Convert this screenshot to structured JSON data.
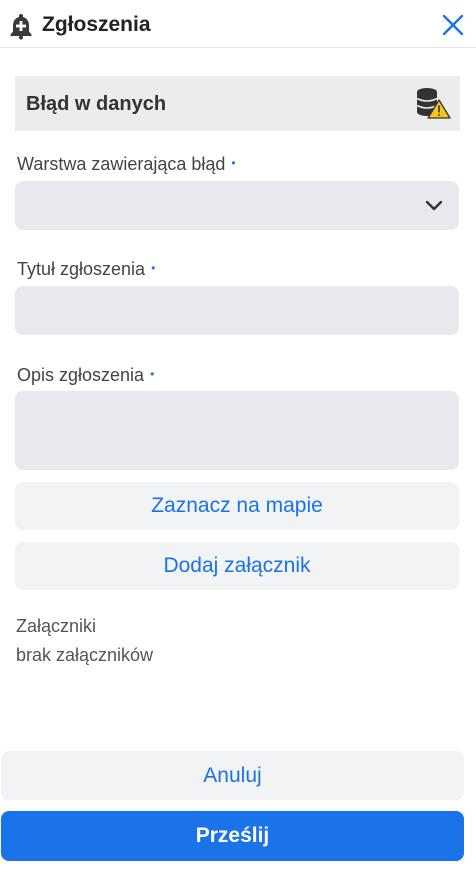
{
  "header": {
    "title": "Zgłoszenia",
    "icon": "bell-plus-icon",
    "close_icon": "close-icon"
  },
  "section": {
    "title": "Błąd w danych",
    "icon": "database-warning-icon"
  },
  "form": {
    "layer": {
      "label": "Warstwa zawierająca błąd",
      "value": ""
    },
    "title": {
      "label": "Tytuł zgłoszenia",
      "value": ""
    },
    "description": {
      "label": "Opis zgłoszenia",
      "value": ""
    },
    "required_marker": "•"
  },
  "buttons": {
    "mark_on_map": "Zaznacz na mapie",
    "add_attachment": "Dodaj załącznik",
    "cancel": "Anuluj",
    "submit": "Prześlij"
  },
  "attachments": {
    "heading": "Załączniki",
    "empty_text": "brak załączników"
  },
  "colors": {
    "accent": "#1a73e8",
    "field_bg": "#e7e9ed",
    "section_bg": "#ececec"
  }
}
